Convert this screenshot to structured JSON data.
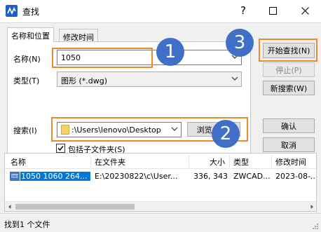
{
  "window": {
    "title": "查找",
    "help_glyph": "?",
    "app_icon": "cad-app-icon"
  },
  "tabs": [
    {
      "label": "名称和位置",
      "active": true
    },
    {
      "label": "修改时间",
      "active": false
    }
  ],
  "form": {
    "name_label": "名称(N)",
    "name_value": "1050",
    "type_label": "类型(T)",
    "type_value": "图形 (*.dwg)",
    "search_label": "搜索(I)",
    "search_value": ":\\Users\\lenovo\\Desktop",
    "browse_label": "浏览(B)...",
    "subfolders_label": "包括子文件夹(S)",
    "subfolders_checked": true
  },
  "buttons": {
    "start": "开始查找(N)",
    "stop": "停止(P)",
    "new_search": "新搜索(W)",
    "ok": "确认",
    "cancel": "取消"
  },
  "markers": [
    "1",
    "2",
    "3"
  ],
  "results": {
    "columns": [
      "名称",
      "在文件夹",
      "大小",
      "类型",
      "修改时间"
    ],
    "rows": [
      {
        "name": "1050 1060 264...",
        "folder": "E:\\20230822\\c\\User...",
        "size": "336, 343",
        "type": "ZWCAD...",
        "modified": "2023-08-..."
      }
    ]
  },
  "status": {
    "text": "找到1 个文件"
  },
  "colors": {
    "highlight": "#e98a2c",
    "marker": "#3f6fc6",
    "selection": "#0078d7"
  }
}
